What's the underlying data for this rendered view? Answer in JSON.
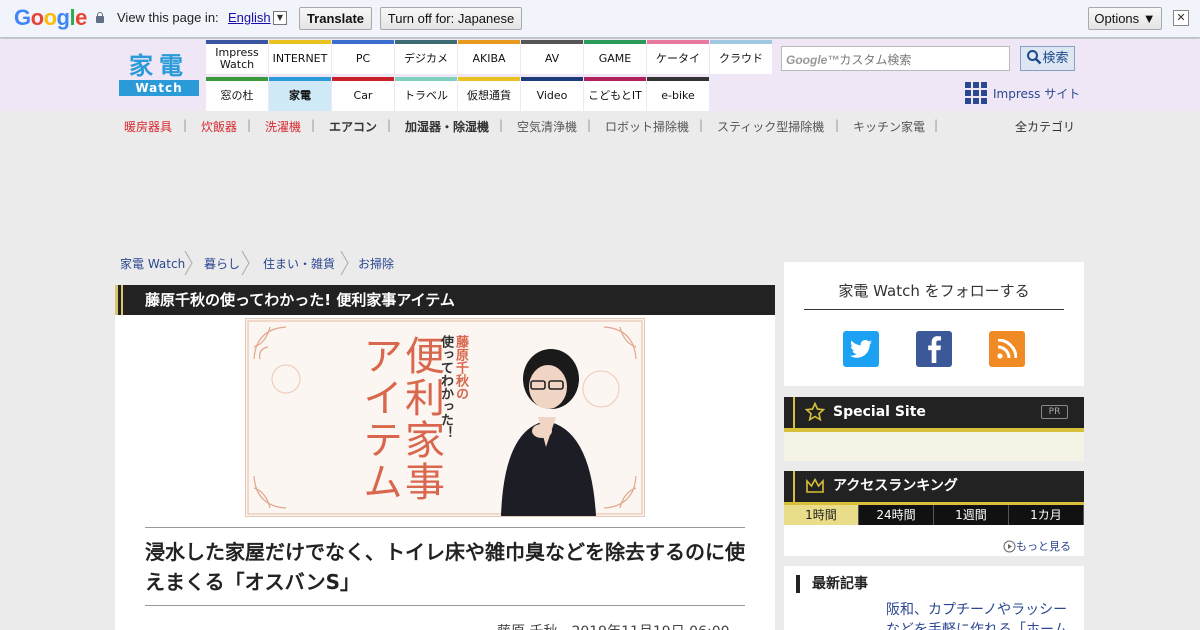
{
  "translate_bar": {
    "view_label": "View this page in:",
    "language": "English",
    "dropdown_glyph": "▼",
    "translate_button": "Translate",
    "turn_off_button": "Turn off for: Japanese",
    "options_button": "Options ▼",
    "close_glyph": "✕"
  },
  "logo": {
    "kanji": "家電",
    "watch": "Watch"
  },
  "nav_top": [
    "Impress\nWatch",
    "INTERNET",
    "PC",
    "デジカメ",
    "AKIBA",
    "AV",
    "GAME",
    "ケータイ",
    "クラウド"
  ],
  "nav_top_colors": [
    "#3a56a0",
    "#e8c21e",
    "#3a6fcf",
    "#3d6b73",
    "#e89a1e",
    "#555555",
    "#2a9a5a",
    "#e87aa0",
    "#9fc8e0"
  ],
  "nav_bottom": [
    "窓の杜",
    "家電",
    "Car",
    "トラベル",
    "仮想通貨",
    "Video",
    "こどもとIT",
    "e-bike"
  ],
  "nav_bottom_colors": [
    "#3a9a3a",
    "#2a9ad9",
    "#c9202a",
    "#7fd0c0",
    "#e8c21e",
    "#1d3a7a",
    "#b0205a",
    "#333333"
  ],
  "search": {
    "placeholder_brand": "Google™",
    "placeholder": "カスタム検索",
    "button": "検索"
  },
  "impress_site": "Impress サイト",
  "categories": [
    {
      "label": "暖房器具",
      "color": "#d8282f",
      "bold": false
    },
    {
      "label": "炊飯器",
      "color": "#d8282f",
      "bold": false
    },
    {
      "label": "洗濯機",
      "color": "#d8282f",
      "bold": false
    },
    {
      "label": "エアコン",
      "color": "#333333",
      "bold": true
    },
    {
      "label": "加湿器・除湿機",
      "color": "#333333",
      "bold": true
    },
    {
      "label": "空気清浄機",
      "color": "#555555",
      "bold": false
    },
    {
      "label": "ロボット掃除機",
      "color": "#555555",
      "bold": false
    },
    {
      "label": "スティック型掃除機",
      "color": "#555555",
      "bold": false
    },
    {
      "label": "キッチン家電",
      "color": "#555555",
      "bold": false
    }
  ],
  "all_categories": "全カテゴリ",
  "breadcrumb": [
    "家電 Watch",
    "暮らし",
    "住まい・雑貨",
    "お掃除"
  ],
  "series_title": "藤原千秋の使ってわかった! 便利家事アイテム",
  "banner": {
    "title_big": "便利家事アイテム",
    "title_small_name": "藤原千秋の",
    "title_small_rest": "使ってわかった！"
  },
  "article": {
    "headline": "浸水した家屋だけでなく、トイレ床や雑巾臭などを除去するのに使えまくる「オスバンS」",
    "byline": "藤原 千秋　2019年11月19日 06:00"
  },
  "sidebar": {
    "follow_title": "家電 Watch をフォローする",
    "special_site": "Special Site",
    "pr_badge": "PR",
    "ranking_title": "アクセスランキング",
    "ranking_tabs": [
      "1時間",
      "24時間",
      "1週間",
      "1カ月"
    ],
    "more": "もっと見る",
    "latest_title": "最新記事",
    "latest_item": "阪和、カプチーノやラッシーなどを手軽に作れる「ホーム"
  }
}
